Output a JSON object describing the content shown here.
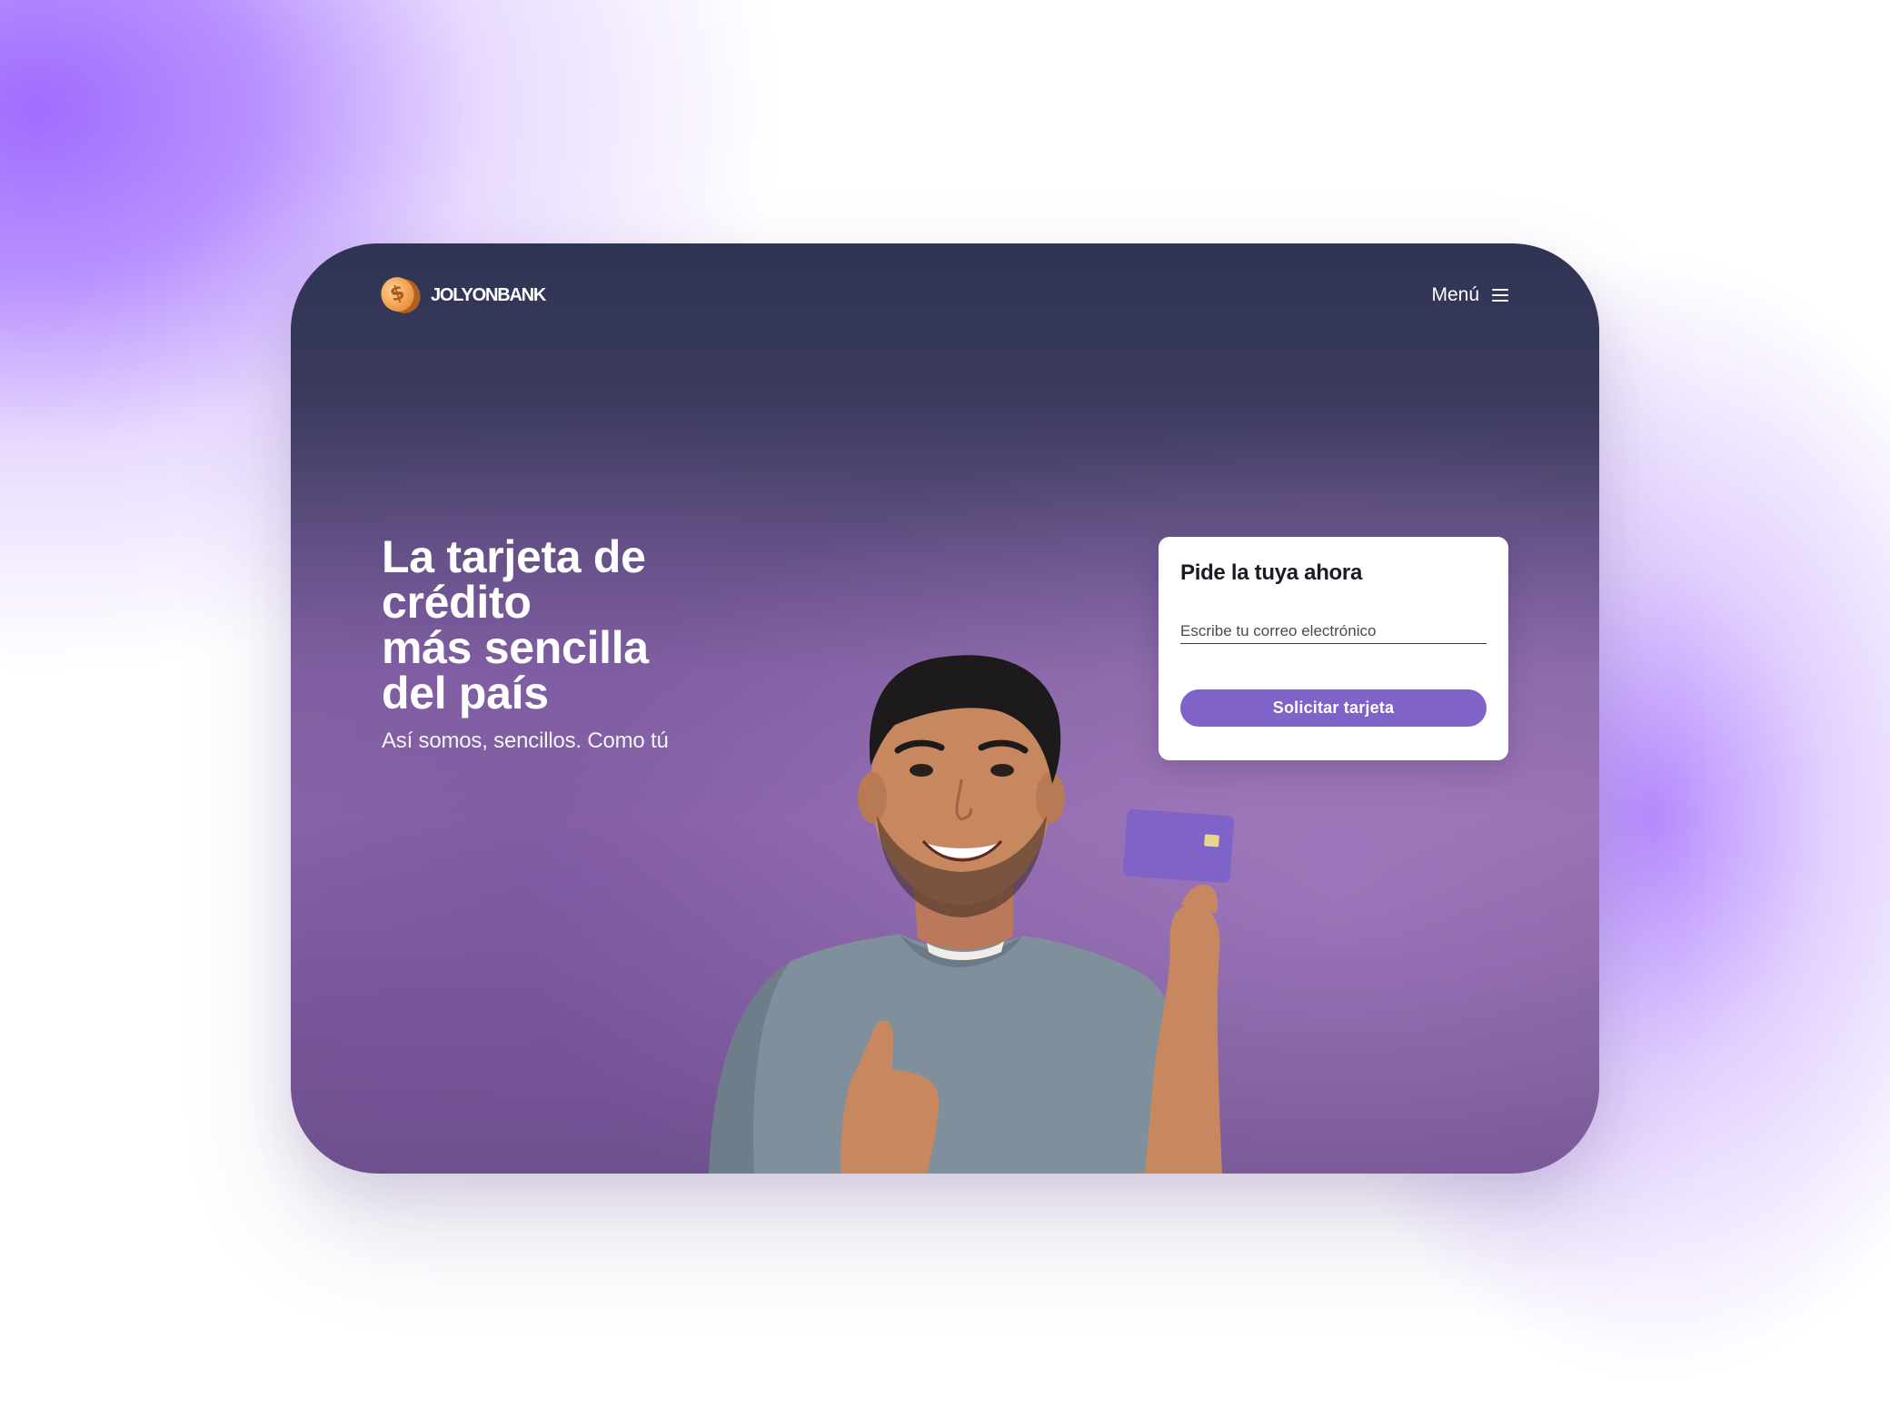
{
  "brand": {
    "name": "JOLYONBANK",
    "logo_icon": "coin-icon",
    "logo_mark": "$"
  },
  "nav": {
    "menu_label": "Menú",
    "menu_icon": "hamburger-menu-icon"
  },
  "hero": {
    "headline_lines": [
      "La tarjeta de",
      "crédito",
      "más sencilla",
      "del país"
    ],
    "subhead": "Así somos, sencillos. Como tú"
  },
  "signup": {
    "title": "Pide la tuya ahora",
    "email_placeholder": "Escribe tu correo electrónico",
    "email_value": "",
    "submit_label": "Solicitar tarjeta"
  },
  "colors": {
    "accent": "#7f63c8",
    "card_top": "#2f3453",
    "card_bottom": "#8e6aa8",
    "coin": "#f3a95a"
  }
}
